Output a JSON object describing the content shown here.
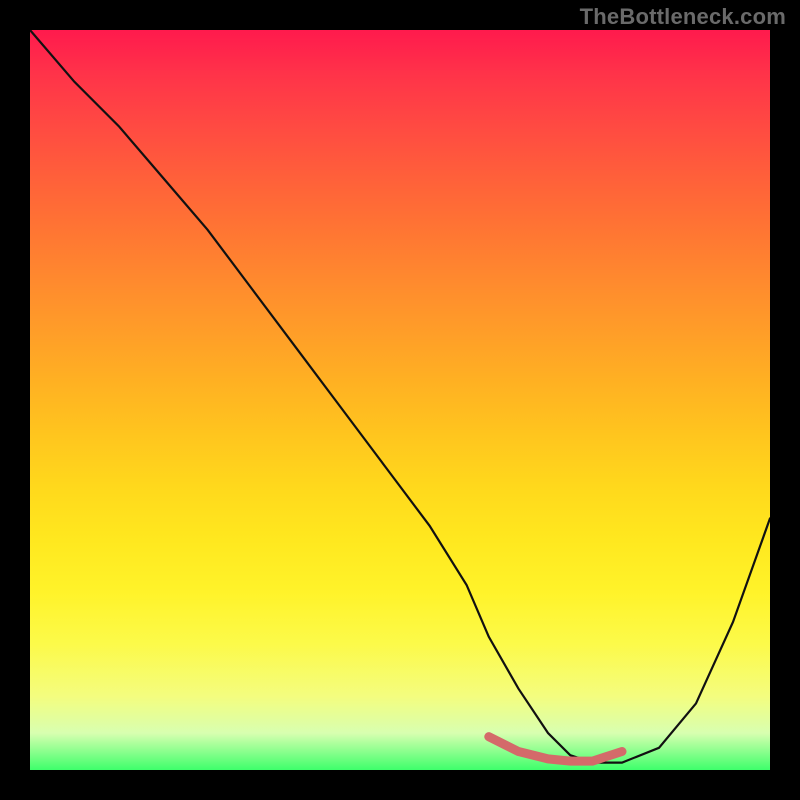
{
  "watermark": "TheBottleneck.com",
  "chart_data": {
    "type": "line",
    "title": "",
    "xlabel": "",
    "ylabel": "",
    "xlim": [
      0,
      100
    ],
    "ylim": [
      0,
      100
    ],
    "grid": false,
    "series": [
      {
        "name": "bottleneck-curve",
        "color": "#111111",
        "x": [
          0,
          6,
          12,
          18,
          24,
          30,
          36,
          42,
          48,
          54,
          59,
          62,
          66,
          70,
          73,
          76,
          80,
          85,
          90,
          95,
          100
        ],
        "y": [
          100,
          93,
          87,
          80,
          73,
          65,
          57,
          49,
          41,
          33,
          25,
          18,
          11,
          5,
          2,
          1,
          1,
          3,
          9,
          20,
          34
        ]
      }
    ],
    "highlight": {
      "name": "optimal-range",
      "color": "#d46a6a",
      "x": [
        62,
        66,
        70,
        73,
        76,
        80
      ],
      "y": [
        4.5,
        2.5,
        1.5,
        1.2,
        1.2,
        2.5
      ]
    },
    "gradient_stops": [
      {
        "pos": 0.0,
        "color": "#ff1a4d"
      },
      {
        "pos": 0.5,
        "color": "#ffb222"
      },
      {
        "pos": 0.85,
        "color": "#fcfa4a"
      },
      {
        "pos": 1.0,
        "color": "#3eff6b"
      }
    ]
  }
}
